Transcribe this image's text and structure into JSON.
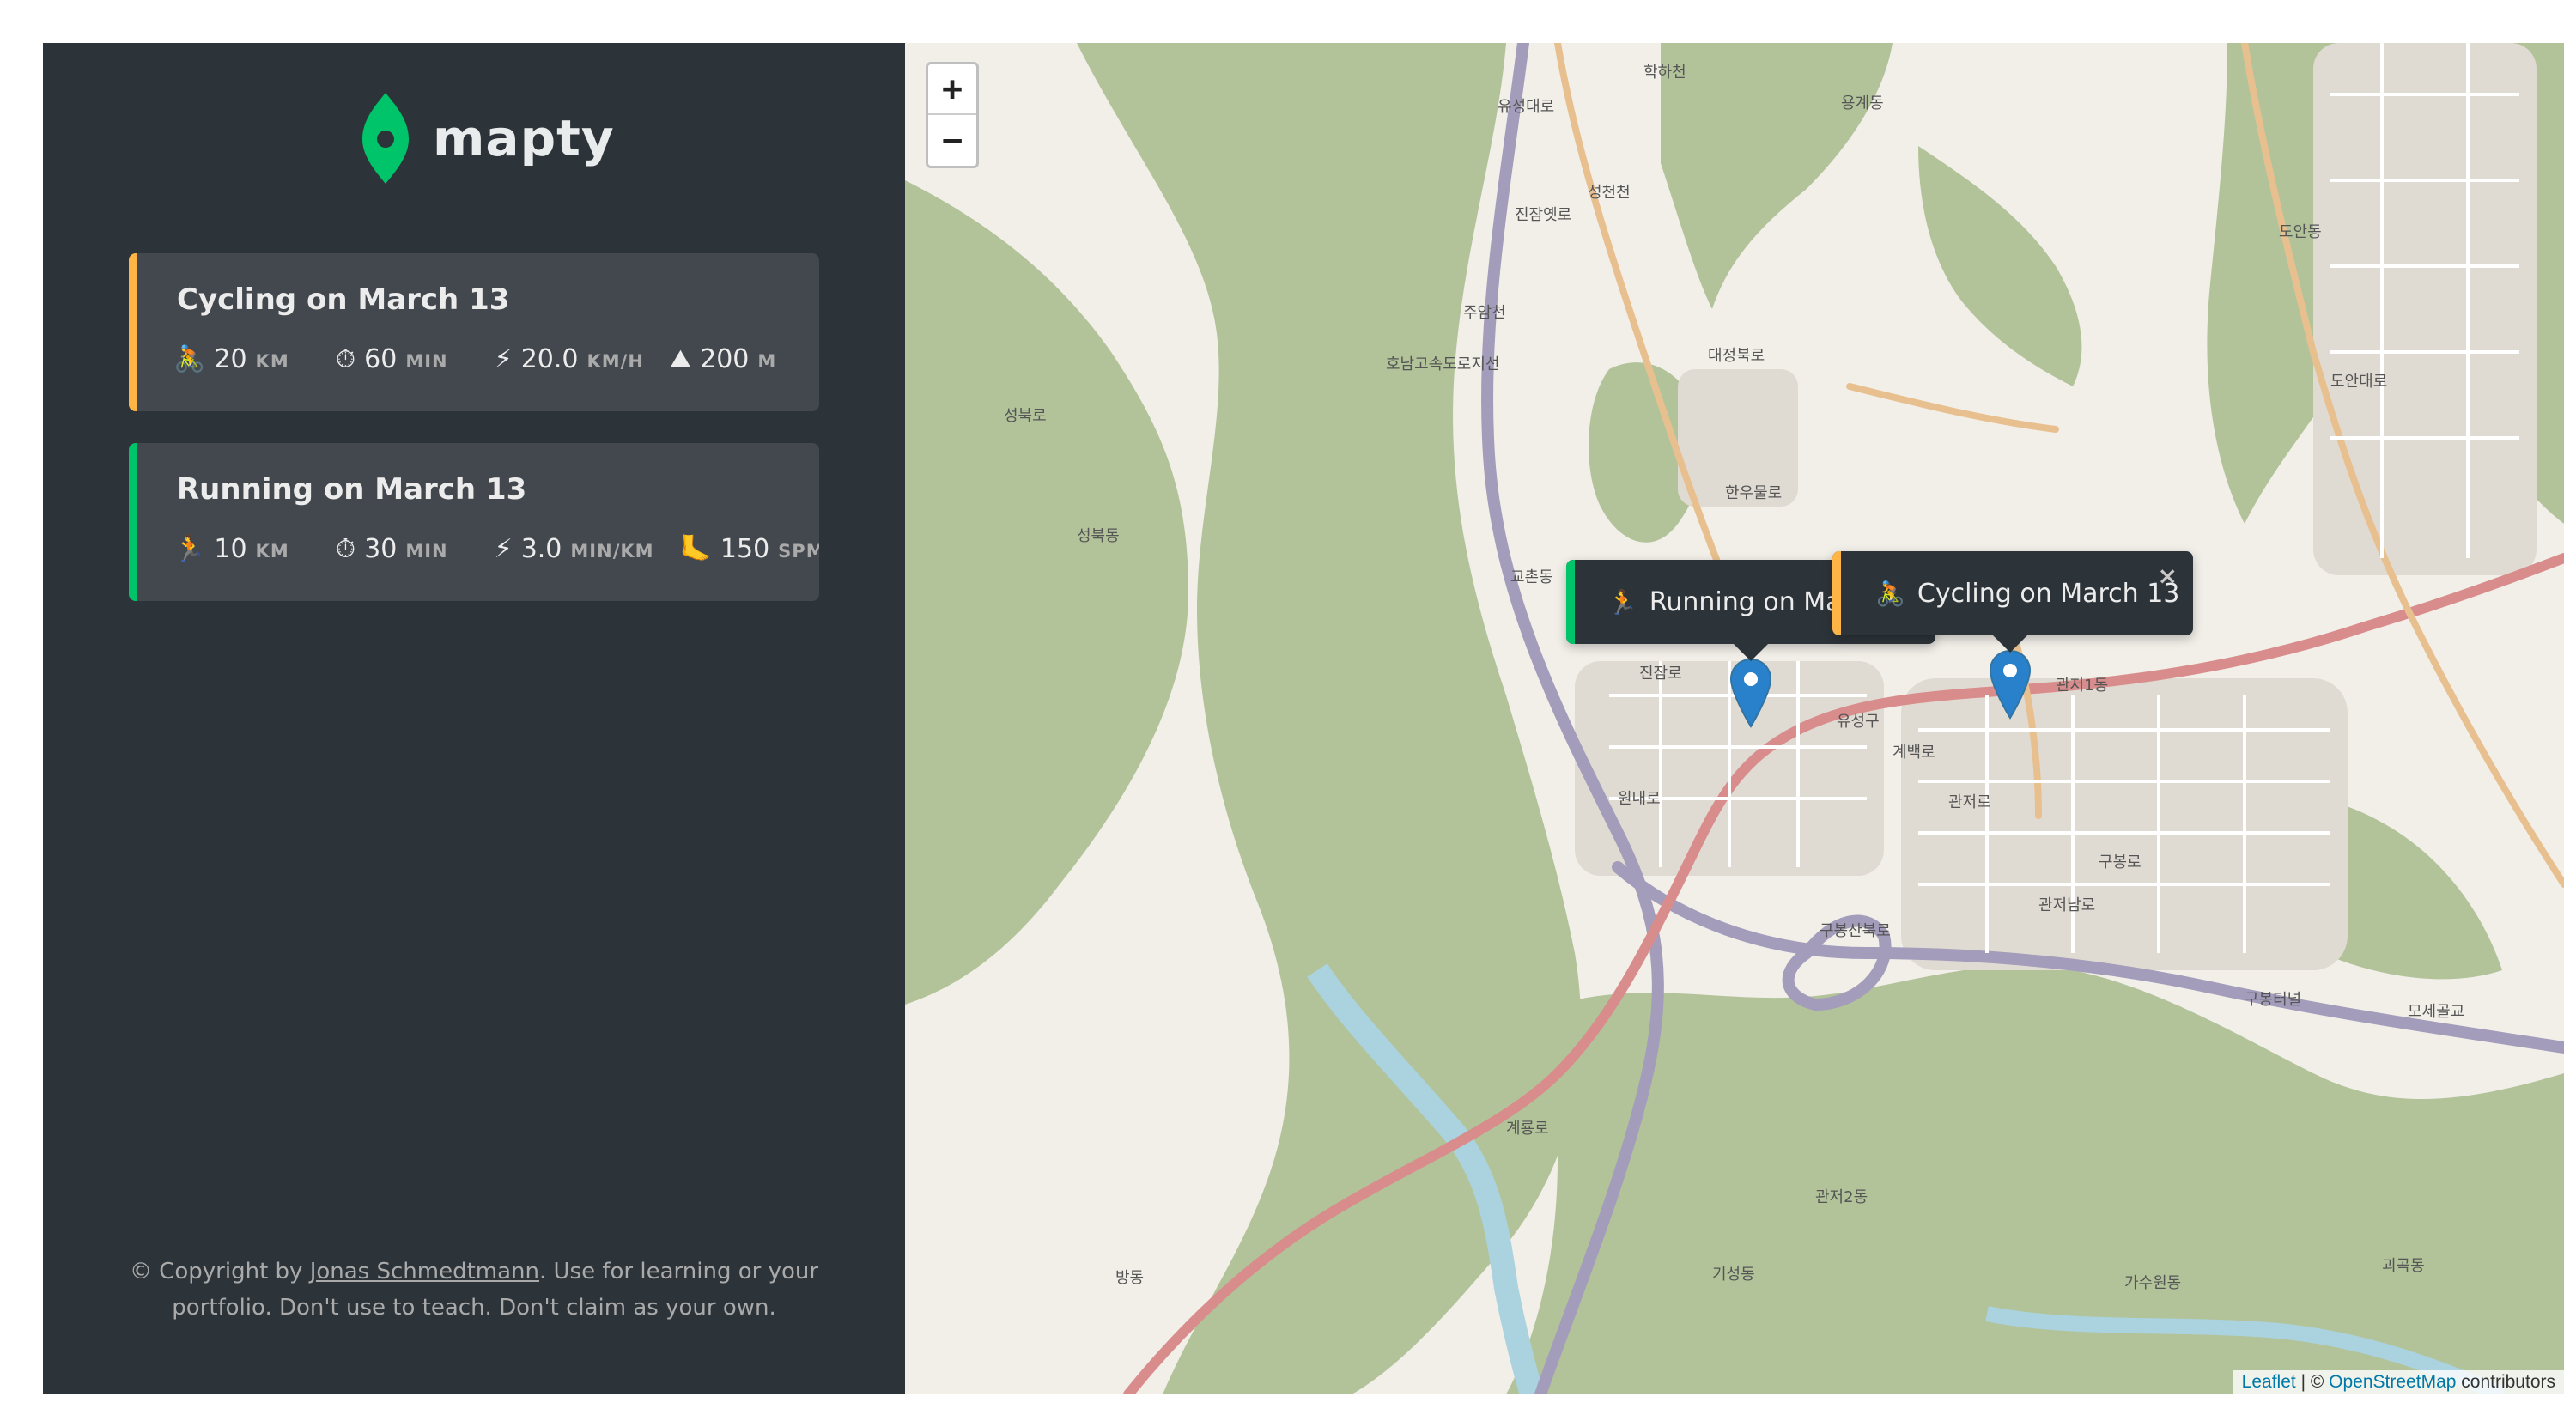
{
  "logo": {
    "text": "mapty",
    "color": "#00c46a"
  },
  "workouts": [
    {
      "type": "cycling",
      "title": "Cycling on March 13",
      "accent": "#ffb545",
      "details": [
        {
          "icon": "🚴",
          "value": "20",
          "unit": "KM"
        },
        {
          "icon": "⏱",
          "value": "60",
          "unit": "MIN"
        },
        {
          "icon": "⚡",
          "value": "20.0",
          "unit": "KM/H"
        },
        {
          "icon": "⛰",
          "value": "200",
          "unit": "M"
        }
      ]
    },
    {
      "type": "running",
      "title": "Running on March 13",
      "accent": "#00c46a",
      "details": [
        {
          "icon": "🏃",
          "value": "10",
          "unit": "KM"
        },
        {
          "icon": "⏱",
          "value": "30",
          "unit": "MIN"
        },
        {
          "icon": "⚡",
          "value": "3.0",
          "unit": "MIN/KM"
        },
        {
          "icon": "🦶",
          "value": "150",
          "unit": "SPM"
        }
      ]
    }
  ],
  "copyright": {
    "prefix": "© Copyright by ",
    "author": "Jonas Schmedtmann",
    "suffix": ". Use for learning or your portfolio. Don't use to teach. Don't claim as your own."
  },
  "map": {
    "zoom_in": "+",
    "zoom_out": "−",
    "popups": {
      "running": {
        "icon": "🏃",
        "text": "Running on March 13"
      },
      "cycling": {
        "icon": "🚴",
        "text": "Cycling on March 13",
        "close": "×"
      }
    },
    "attribution": {
      "leaflet": "Leaflet",
      "separator": " | © ",
      "osm": "OpenStreetMap",
      "suffix": " contributors"
    },
    "labels": [
      "대정북로",
      "한우물로",
      "관저로",
      "구봉로",
      "계백로",
      "관저남로",
      "구봉산북로",
      "계룡로",
      "원내로",
      "진잠로",
      "성북로",
      "성북동",
      "교촌동",
      "도안동",
      "가수원동",
      "관저2동",
      "기성동",
      "괴곡동",
      "구봉터널",
      "모세골교",
      "유성대로",
      "주암천",
      "성천천",
      "학하천",
      "용계동",
      "방동",
      "진잠옛로",
      "호남고속도로지선",
      "도안대로",
      "유성구",
      "관저1동"
    ]
  }
}
